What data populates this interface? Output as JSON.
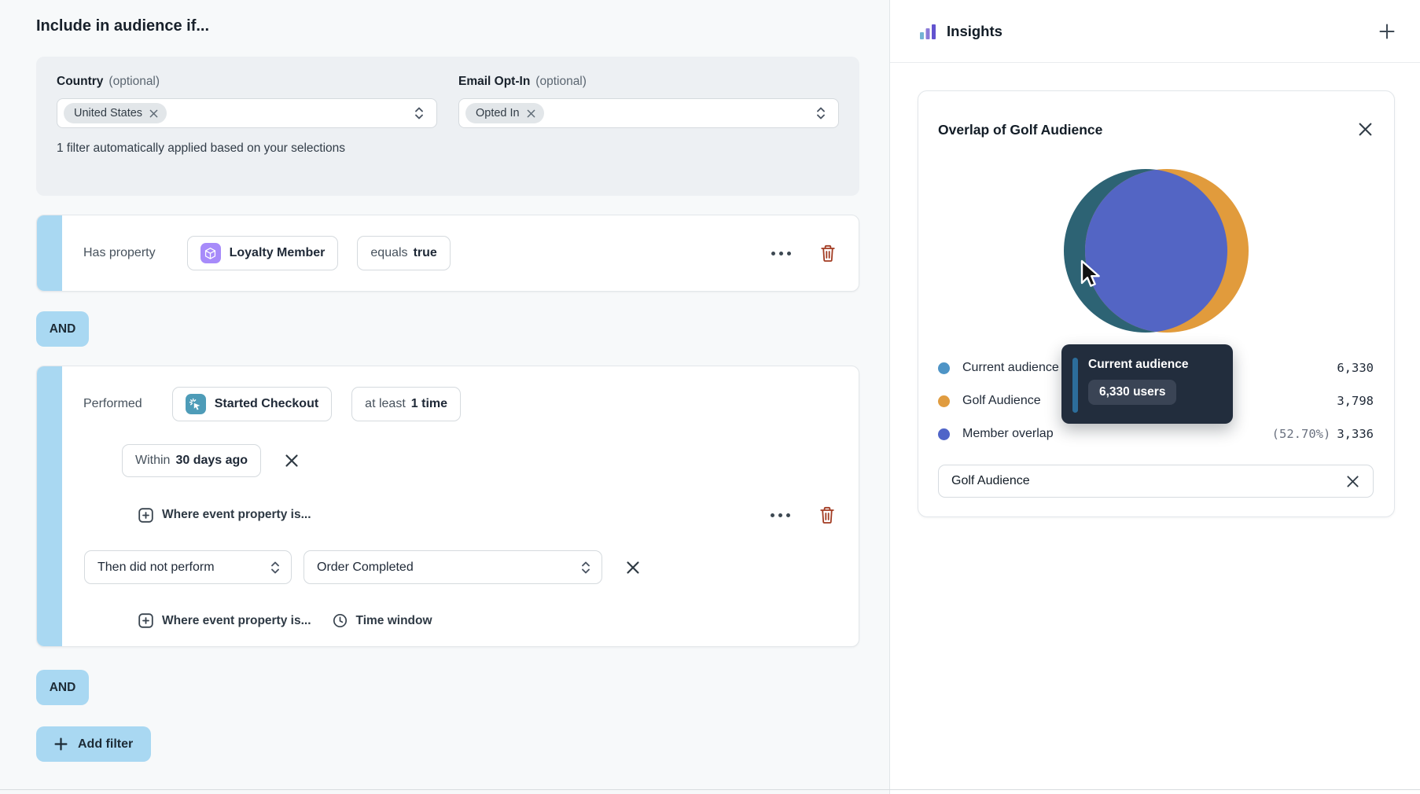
{
  "header": {
    "title": "Include in audience if..."
  },
  "prefilter": {
    "fields": [
      {
        "label": "Country",
        "optional_tag": "(optional)",
        "chip": "United States"
      },
      {
        "label": "Email Opt-In",
        "optional_tag": "(optional)",
        "chip": "Opted In"
      }
    ],
    "note": "1 filter automatically applied based on your selections"
  },
  "property_rule": {
    "prefix": "Has property",
    "property": "Loyalty Member",
    "operator": "equals",
    "value": "true"
  },
  "connector": {
    "label": "AND"
  },
  "event_rule": {
    "prefix": "Performed",
    "event": "Started Checkout",
    "frequency_prefix": "at least",
    "frequency": "1 time",
    "window_prefix": "Within",
    "window": "30 days ago",
    "add_property_label": "Where event property is...",
    "negation": {
      "select": "Then did not perform",
      "event": "Order Completed",
      "add_property_label": "Where event property is...",
      "time_window_label": "Time window"
    }
  },
  "actions": {
    "add_filter": "Add filter"
  },
  "insights": {
    "title": "Insights",
    "card": {
      "title": "Overlap of Golf Audience",
      "audience_input_value": "Golf Audience",
      "legend": [
        {
          "label": "Current audience",
          "value": "6,330",
          "color": "#4E94C6"
        },
        {
          "label": "Golf Audience",
          "value": "3,798",
          "color": "#E09C40"
        },
        {
          "label": "Member overlap",
          "percent": "(52.70%)",
          "value": "3,336",
          "color": "#5065C8"
        }
      ],
      "tooltip": {
        "title": "Current audience",
        "value": "6,330 users"
      }
    },
    "venn_colors": {
      "left": "#2D6374",
      "right": "#E19B3C",
      "overlap": "#5365C4"
    },
    "accent_color": "#A9D8F2"
  },
  "chart_data": {
    "type": "venn",
    "title": "Overlap of Golf Audience",
    "sets": [
      {
        "label": "Current audience",
        "size": 6330,
        "color": "#2D6374"
      },
      {
        "label": "Golf Audience",
        "size": 3798,
        "color": "#E19B3C"
      }
    ],
    "overlap": {
      "label": "Member overlap",
      "size": 3336,
      "percent": "52.70%",
      "color": "#5365C4"
    },
    "legend_position": "bottom"
  }
}
